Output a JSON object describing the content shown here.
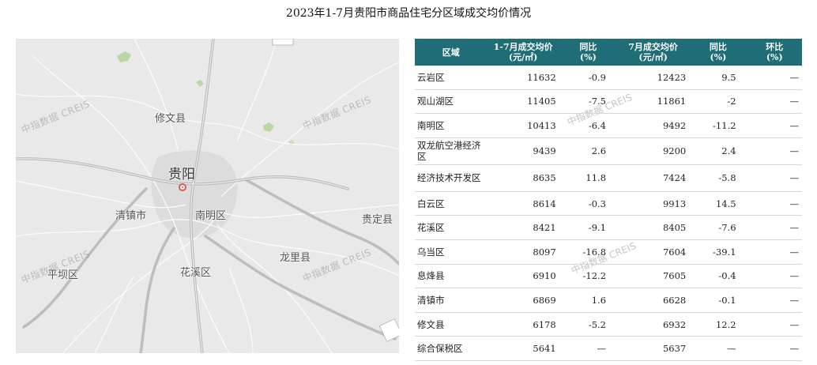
{
  "title": "2023年1-7月贵阳市商品住宅分区域成交均价情况",
  "map": {
    "labels": {
      "xiuwen": "修文县",
      "guiyang": "贵阳",
      "qingzhen": "清镇市",
      "nanming": "南明区",
      "guiding": "贵定县",
      "longli": "龙里县",
      "pingba": "平坝区",
      "huaxi": "花溪区"
    },
    "watermark": "中指数据 CREIS"
  },
  "table": {
    "headers": {
      "region": "区域",
      "avg_ytd": "1-7月成交均价\n(元/㎡)",
      "yoy_ytd": "同比\n(%)",
      "avg_jul": "7月成交均价\n(元/㎡)",
      "yoy_jul": "同比\n(%)",
      "mom": "环比\n(%)"
    },
    "rows": [
      {
        "region": "云岩区",
        "avg_ytd": "11632",
        "yoy_ytd": "-0.9",
        "avg_jul": "12423",
        "yoy_jul": "9.5",
        "mom": "—"
      },
      {
        "region": "观山湖区",
        "avg_ytd": "11405",
        "yoy_ytd": "-7.5",
        "avg_jul": "11861",
        "yoy_jul": "-2",
        "mom": "—"
      },
      {
        "region": "南明区",
        "avg_ytd": "10413",
        "yoy_ytd": "-6.4",
        "avg_jul": "9492",
        "yoy_jul": "-11.2",
        "mom": "—"
      },
      {
        "region": "双龙航空港经济区",
        "avg_ytd": "9439",
        "yoy_ytd": "2.6",
        "avg_jul": "9200",
        "yoy_jul": "2.4",
        "mom": "—"
      },
      {
        "region": "经济技术开发区",
        "avg_ytd": "8635",
        "yoy_ytd": "11.8",
        "avg_jul": "7424",
        "yoy_jul": "-5.8",
        "mom": "—"
      },
      {
        "region": "白云区",
        "avg_ytd": "8614",
        "yoy_ytd": "-0.3",
        "avg_jul": "9913",
        "yoy_jul": "14.5",
        "mom": "—"
      },
      {
        "region": "花溪区",
        "avg_ytd": "8421",
        "yoy_ytd": "-9.1",
        "avg_jul": "8405",
        "yoy_jul": "-7.6",
        "mom": "—"
      },
      {
        "region": "乌当区",
        "avg_ytd": "8097",
        "yoy_ytd": "-16.8",
        "avg_jul": "7604",
        "yoy_jul": "-39.1",
        "mom": "—"
      },
      {
        "region": "息烽县",
        "avg_ytd": "6910",
        "yoy_ytd": "-12.2",
        "avg_jul": "7605",
        "yoy_jul": "-0.4",
        "mom": "—"
      },
      {
        "region": "清镇市",
        "avg_ytd": "6869",
        "yoy_ytd": "1.6",
        "avg_jul": "6628",
        "yoy_jul": "-0.1",
        "mom": "—"
      },
      {
        "region": "修文县",
        "avg_ytd": "6178",
        "yoy_ytd": "-5.2",
        "avg_jul": "6932",
        "yoy_jul": "12.2",
        "mom": "—"
      },
      {
        "region": "综合保税区",
        "avg_ytd": "5641",
        "yoy_ytd": "—",
        "avg_jul": "5637",
        "yoy_jul": "—",
        "mom": "—"
      }
    ]
  }
}
